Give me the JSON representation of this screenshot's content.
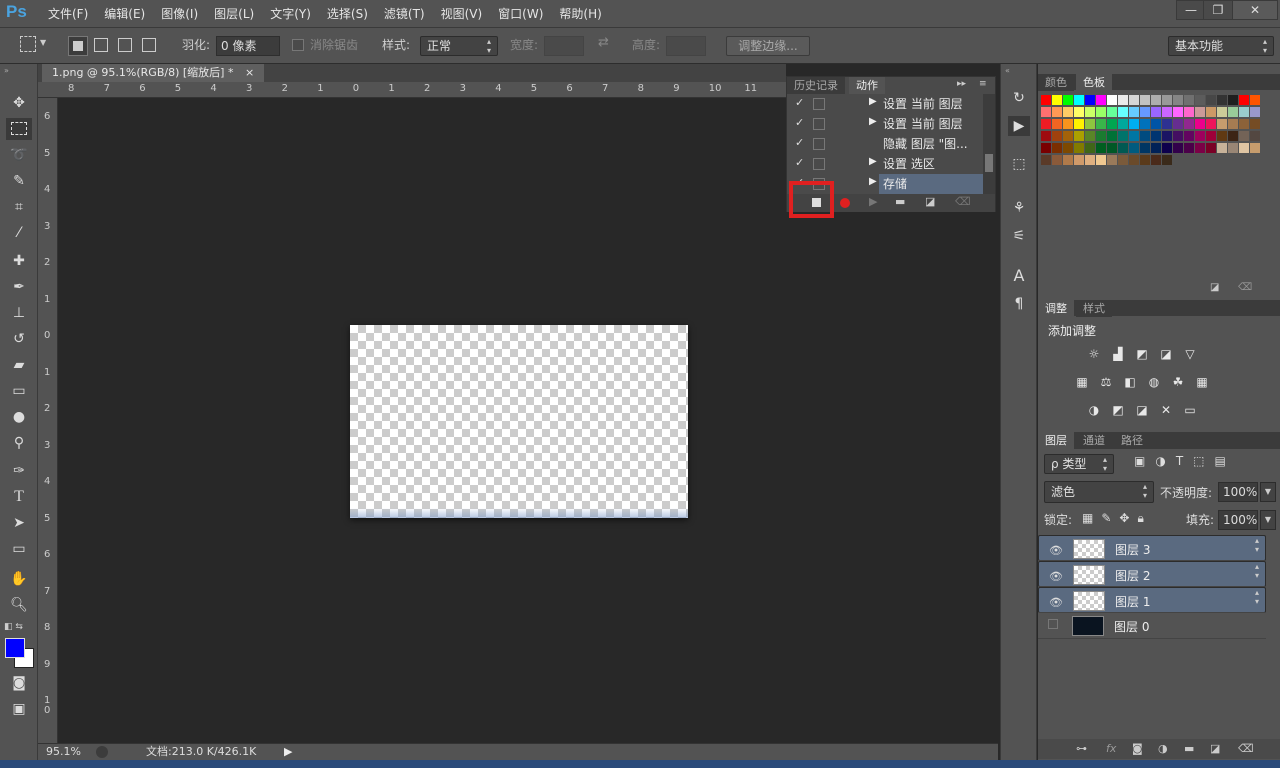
{
  "app": {
    "logo": "Ps"
  },
  "menu": [
    "文件(F)",
    "编辑(E)",
    "图像(I)",
    "图层(L)",
    "文字(Y)",
    "选择(S)",
    "滤镜(T)",
    "视图(V)",
    "窗口(W)",
    "帮助(H)"
  ],
  "window_controls": {
    "minimize": "—",
    "restore": "❐",
    "close": "✕"
  },
  "options": {
    "feather_label": "羽化:",
    "feather_value": "0 像素",
    "antialias_label": "消除锯齿",
    "style_label": "样式:",
    "style_value": "正常",
    "width_label": "宽度:",
    "height_label": "高度:",
    "refine_edge": "调整边缘...",
    "workspace": "基本功能"
  },
  "doc_tab": {
    "title": "1.png @ 95.1%(RGB/8) [缩放后] *",
    "close": "×"
  },
  "ruler_h": [
    "8",
    "7",
    "6",
    "5",
    "4",
    "3",
    "2",
    "1",
    "0",
    "1",
    "2",
    "3",
    "4",
    "5",
    "6",
    "7",
    "8",
    "9",
    "10",
    "11"
  ],
  "ruler_v": [
    "6",
    "5",
    "4",
    "3",
    "2",
    "1",
    "0",
    "1",
    "2",
    "3",
    "4",
    "5",
    "6",
    "7",
    "8",
    "9",
    "1 0"
  ],
  "status": {
    "zoom": "95.1%",
    "doc": "文档:213.0 K/426.1K"
  },
  "actions_panel": {
    "tabs": [
      "历史记录",
      "动作"
    ],
    "rows": [
      {
        "check": "✓",
        "arrow": "▶",
        "name": "设置 当前 图层"
      },
      {
        "check": "✓",
        "arrow": "▶",
        "name": "设置 当前 图层"
      },
      {
        "check": "✓",
        "arrow": "",
        "name": "隐藏 图层 \"图..."
      },
      {
        "check": "✓",
        "arrow": "▶",
        "name": "设置 选区"
      },
      {
        "check": "✓",
        "arrow": "▶",
        "name": "存储"
      }
    ],
    "highlight_color": "#e02020"
  },
  "swatches_panel": {
    "tabs": [
      "颜色",
      "色板"
    ],
    "colors": [
      "#ff0000",
      "#ffff00",
      "#00ff00",
      "#00ffff",
      "#0000ff",
      "#ff00ff",
      "#ffffff",
      "#ebebeb",
      "#d6d6d6",
      "#c2c2c2",
      "#adadad",
      "#999999",
      "#858585",
      "#707070",
      "#5c5c5c",
      "#474747",
      "#333333",
      "#1f1f1f",
      "#ff0000",
      "#ff5500",
      "#ff7070",
      "#ff9955",
      "#ffcc66",
      "#ffff66",
      "#ccff66",
      "#99ff66",
      "#66ff99",
      "#66ffff",
      "#66ccff",
      "#6699ff",
      "#9966ff",
      "#cc66ff",
      "#ff66ff",
      "#ff66cc",
      "#cc9999",
      "#cc9966",
      "#cccc99",
      "#99cc99",
      "#99cccc",
      "#9999cc",
      "#ed1c24",
      "#f26522",
      "#f7941d",
      "#fff200",
      "#8dc63f",
      "#39b54a",
      "#00a651",
      "#00a99d",
      "#00aeef",
      "#0072bc",
      "#0054a6",
      "#2e3192",
      "#662d91",
      "#92278f",
      "#ec008c",
      "#ed145b",
      "#c69c6d",
      "#a67c52",
      "#8c6239",
      "#754c24",
      "#9e0b0f",
      "#a0410d",
      "#a36209",
      "#aba000",
      "#598527",
      "#1a7b30",
      "#007236",
      "#00746b",
      "#0076a3",
      "#004b80",
      "#003471",
      "#1b1464",
      "#440e62",
      "#630460",
      "#9e005d",
      "#9e0039",
      "#603913",
      "#3c2415",
      "#736357",
      "#534741",
      "#790000",
      "#7b2e00",
      "#7d4900",
      "#827b00",
      "#406618",
      "#005e20",
      "#005826",
      "#005952",
      "#005b7f",
      "#003663",
      "#002157",
      "#0d004c",
      "#32004b",
      "#4b0049",
      "#7b0046",
      "#7a0026",
      "#c7b299",
      "#998675",
      "#dfc5a3",
      "#c69c6d",
      "#5a3a28",
      "#8a5a3a",
      "#b07a4a",
      "#d09a6a",
      "#e0b080",
      "#f0c890",
      "#9a7a5a",
      "#7a5a3a",
      "#6a4a2a",
      "#5a3a1a",
      "#4a2a1a",
      "#3a2a1a"
    ]
  },
  "adjust_panel": {
    "tabs": [
      "调整",
      "样式"
    ],
    "title": "添加调整"
  },
  "layers_panel": {
    "tabs": [
      "图层",
      "通道",
      "路径"
    ],
    "filter": "ρ 类型",
    "blend_mode": "滤色",
    "opacity_label": "不透明度:",
    "opacity": "100%",
    "lock_label": "锁定:",
    "fill_label": "填充:",
    "fill": "100%",
    "layers": [
      {
        "name": "图层 3",
        "visible": true,
        "selected": true
      },
      {
        "name": "图层 2",
        "visible": true,
        "selected": true
      },
      {
        "name": "图层 1",
        "visible": true,
        "selected": true
      },
      {
        "name": "图层 0",
        "visible": false,
        "selected": false
      }
    ]
  },
  "colors": {
    "foreground": "#0000ff",
    "background": "#ffffff"
  }
}
